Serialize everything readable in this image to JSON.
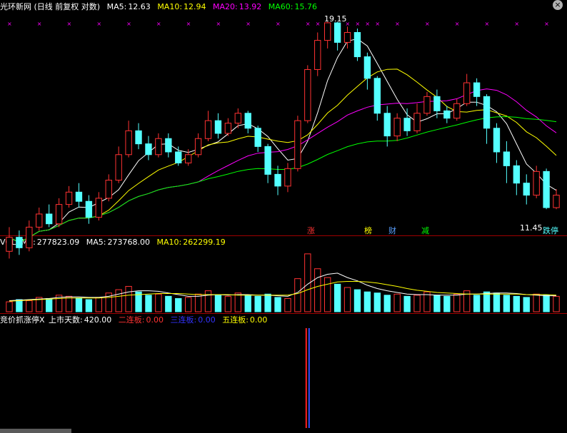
{
  "header": {
    "name": "光环新网",
    "mode": "(日线 前复权 对数)",
    "ma5_label": "MA5:",
    "ma5": "12.63",
    "ma10_label": "MA10:",
    "ma10": "12.94",
    "ma20_label": "MA20:",
    "ma20": "13.92",
    "ma60_label": "MA60:",
    "ma60": "15.76",
    "close_icon": "close-x-icon"
  },
  "volume_header": {
    "label": "VOLUME:",
    "value": "277823.09",
    "ma5_label": "MA5:",
    "ma5": "273768.00",
    "ma10_label": "MA10:",
    "ma10": "262299.19"
  },
  "indicator_header": {
    "name": "竞价抓涨停X",
    "days_label": "上市天数:",
    "days": "420.00",
    "er_label": "二连板:",
    "er": "0.00",
    "san_label": "三连板:",
    "san": "0.00",
    "wu_label": "五连板:",
    "wu": "0.00"
  },
  "event_markers": [
    "涨",
    "榜",
    "财",
    "减",
    "跌停"
  ],
  "colors": {
    "up": "#ff3232",
    "down": "#54ffff",
    "ma5": "#ffffff",
    "ma10": "#ffff00",
    "ma20": "#ff00ff",
    "ma60": "#00ff00",
    "grid": "#a00000",
    "x_marker": "#ff00ff"
  },
  "chart_data": {
    "type": "candlestick",
    "price_scale": "log",
    "high_label": "19.15",
    "low_label": "11.45",
    "candles": [
      {
        "o": 10.2,
        "c": 10.6,
        "h": 10.9,
        "l": 10.0
      },
      {
        "o": 10.6,
        "c": 10.3,
        "h": 10.8,
        "l": 10.1
      },
      {
        "o": 10.3,
        "c": 10.9,
        "h": 11.1,
        "l": 10.2
      },
      {
        "o": 10.9,
        "c": 11.3,
        "h": 11.5,
        "l": 10.8
      },
      {
        "o": 11.3,
        "c": 11.0,
        "h": 11.6,
        "l": 10.9
      },
      {
        "o": 11.0,
        "c": 11.6,
        "h": 11.8,
        "l": 10.9
      },
      {
        "o": 11.6,
        "c": 12.0,
        "h": 12.2,
        "l": 11.5
      },
      {
        "o": 12.0,
        "c": 11.7,
        "h": 12.3,
        "l": 11.5
      },
      {
        "o": 11.7,
        "c": 11.2,
        "h": 11.9,
        "l": 11.0
      },
      {
        "o": 11.2,
        "c": 11.8,
        "h": 12.0,
        "l": 11.1
      },
      {
        "o": 11.8,
        "c": 12.4,
        "h": 12.6,
        "l": 11.7
      },
      {
        "o": 12.4,
        "c": 13.3,
        "h": 13.6,
        "l": 12.3
      },
      {
        "o": 13.3,
        "c": 14.2,
        "h": 14.6,
        "l": 13.2
      },
      {
        "o": 14.2,
        "c": 13.7,
        "h": 14.5,
        "l": 13.5
      },
      {
        "o": 13.7,
        "c": 13.3,
        "h": 14.0,
        "l": 13.1
      },
      {
        "o": 13.3,
        "c": 13.9,
        "h": 14.1,
        "l": 13.2
      },
      {
        "o": 13.9,
        "c": 13.4,
        "h": 14.1,
        "l": 13.2
      },
      {
        "o": 13.4,
        "c": 13.0,
        "h": 13.6,
        "l": 12.9
      },
      {
        "o": 13.0,
        "c": 13.3,
        "h": 13.5,
        "l": 12.9
      },
      {
        "o": 13.3,
        "c": 13.9,
        "h": 14.1,
        "l": 13.2
      },
      {
        "o": 13.9,
        "c": 14.6,
        "h": 15.0,
        "l": 13.8
      },
      {
        "o": 14.6,
        "c": 14.1,
        "h": 14.9,
        "l": 13.9
      },
      {
        "o": 14.1,
        "c": 14.5,
        "h": 14.7,
        "l": 14.0
      },
      {
        "o": 14.5,
        "c": 14.9,
        "h": 15.1,
        "l": 14.3
      },
      {
        "o": 14.9,
        "c": 14.3,
        "h": 15.0,
        "l": 14.1
      },
      {
        "o": 14.3,
        "c": 13.6,
        "h": 14.4,
        "l": 13.4
      },
      {
        "o": 13.6,
        "c": 12.6,
        "h": 13.7,
        "l": 12.3
      },
      {
        "o": 12.6,
        "c": 12.2,
        "h": 12.9,
        "l": 11.9
      },
      {
        "o": 12.2,
        "c": 12.8,
        "h": 13.0,
        "l": 12.0
      },
      {
        "o": 12.8,
        "c": 14.6,
        "h": 14.8,
        "l": 12.7
      },
      {
        "o": 14.6,
        "c": 16.8,
        "h": 17.0,
        "l": 14.5
      },
      {
        "o": 16.8,
        "c": 18.2,
        "h": 18.6,
        "l": 16.5
      },
      {
        "o": 18.2,
        "c": 19.1,
        "h": 19.15,
        "l": 17.8
      },
      {
        "o": 19.1,
        "c": 18.1,
        "h": 19.15,
        "l": 17.7
      },
      {
        "o": 18.1,
        "c": 18.6,
        "h": 18.9,
        "l": 17.8
      },
      {
        "o": 18.6,
        "c": 17.4,
        "h": 18.8,
        "l": 17.2
      },
      {
        "o": 17.4,
        "c": 16.4,
        "h": 17.6,
        "l": 15.9
      },
      {
        "o": 16.4,
        "c": 14.9,
        "h": 16.5,
        "l": 14.6
      },
      {
        "o": 14.9,
        "c": 14.0,
        "h": 15.2,
        "l": 13.6
      },
      {
        "o": 14.0,
        "c": 14.7,
        "h": 14.9,
        "l": 13.8
      },
      {
        "o": 14.7,
        "c": 14.2,
        "h": 15.1,
        "l": 14.0
      },
      {
        "o": 14.2,
        "c": 14.9,
        "h": 15.3,
        "l": 14.1
      },
      {
        "o": 14.9,
        "c": 15.6,
        "h": 15.8,
        "l": 14.8
      },
      {
        "o": 15.6,
        "c": 15.0,
        "h": 15.9,
        "l": 14.7
      },
      {
        "o": 15.0,
        "c": 14.7,
        "h": 15.2,
        "l": 14.5
      },
      {
        "o": 14.7,
        "c": 15.3,
        "h": 15.5,
        "l": 14.6
      },
      {
        "o": 15.3,
        "c": 16.2,
        "h": 16.6,
        "l": 15.2
      },
      {
        "o": 16.2,
        "c": 15.6,
        "h": 16.4,
        "l": 15.2
      },
      {
        "o": 15.6,
        "c": 14.3,
        "h": 15.7,
        "l": 13.7
      },
      {
        "o": 14.3,
        "c": 13.4,
        "h": 14.5,
        "l": 13.0
      },
      {
        "o": 13.4,
        "c": 12.9,
        "h": 13.8,
        "l": 12.3
      },
      {
        "o": 12.9,
        "c": 12.3,
        "h": 13.1,
        "l": 11.9
      },
      {
        "o": 12.3,
        "c": 11.9,
        "h": 12.6,
        "l": 11.6
      },
      {
        "o": 11.9,
        "c": 12.7,
        "h": 12.9,
        "l": 11.8
      },
      {
        "o": 12.7,
        "c": 11.5,
        "h": 12.8,
        "l": 11.45
      },
      {
        "o": 11.5,
        "c": 11.9,
        "h": 12.1,
        "l": 11.45
      }
    ],
    "volume": [
      18,
      22,
      20,
      26,
      24,
      30,
      28,
      25,
      22,
      26,
      34,
      40,
      46,
      36,
      30,
      32,
      28,
      24,
      26,
      32,
      38,
      30,
      28,
      34,
      30,
      28,
      32,
      26,
      24,
      60,
      105,
      78,
      62,
      50,
      44,
      40,
      36,
      34,
      30,
      32,
      28,
      30,
      36,
      30,
      28,
      32,
      38,
      30,
      36,
      34,
      30,
      28,
      26,
      32,
      30,
      28
    ],
    "volume_ma5": [
      20,
      21,
      22,
      23,
      24,
      26,
      27,
      27,
      26,
      26,
      28,
      32,
      36,
      38,
      38,
      37,
      34,
      31,
      28,
      28,
      30,
      31,
      30,
      31,
      31,
      30,
      30,
      29,
      28,
      35,
      50,
      62,
      68,
      70,
      62,
      56,
      48,
      42,
      38,
      35,
      32,
      31,
      31,
      30,
      30,
      30,
      32,
      32,
      33,
      34,
      34,
      33,
      31,
      30,
      29,
      29
    ],
    "volume_ma10": [
      19,
      20,
      21,
      22,
      23,
      24,
      25,
      25,
      25,
      25,
      26,
      28,
      30,
      31,
      32,
      33,
      33,
      33,
      32,
      31,
      31,
      31,
      31,
      30,
      30,
      30,
      30,
      30,
      30,
      33,
      40,
      46,
      50,
      54,
      55,
      55,
      54,
      52,
      49,
      46,
      42,
      39,
      37,
      35,
      34,
      33,
      32,
      32,
      32,
      32,
      32,
      32,
      31,
      31,
      31,
      30
    ],
    "jinjia_signal_index": 30
  }
}
